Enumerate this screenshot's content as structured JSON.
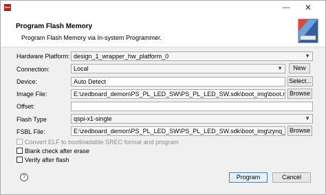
{
  "window": {
    "app_icon_text": "SDK"
  },
  "header": {
    "title": "Program Flash Memory",
    "description": "Program Flash Memory via In-system Programmer."
  },
  "form": {
    "hardware_platform": {
      "label": "Hardware Platform:",
      "value": "design_1_wrapper_hw_platform_0"
    },
    "connection": {
      "label": "Connection:",
      "value": "Local",
      "button": "New"
    },
    "device": {
      "label": "Device:",
      "value": "Auto Detect",
      "button": "Select..."
    },
    "image_file": {
      "label": "Image File:",
      "value": "E:\\zedboard_demon\\PS_PL_LED_SW\\PS_PL_LED_SW.sdk\\boot_img\\boot.mcs",
      "button": "Browse"
    },
    "offset": {
      "label": "Offset:",
      "value": ""
    },
    "flash_type": {
      "label": "Flash Type",
      "value": "qspi-x1-single"
    },
    "fsbl_file": {
      "label": "FSBL File:",
      "value": "E:\\zedboard_demon\\PS_PL_LED_SW\\PS_PL_LED_SW.sdk\\boot_img\\zynq_fsbl.elf",
      "button": "Browse"
    }
  },
  "options": [
    {
      "label": "Convert ELF to bootloadable SREC format and program",
      "enabled": false
    },
    {
      "label": "Blank check after erase",
      "enabled": true
    },
    {
      "label": "Verify after flash",
      "enabled": true
    }
  ],
  "footer": {
    "help_glyph": "?",
    "program_label": "Program",
    "cancel_label": "Cancel"
  },
  "colors": {
    "accent_border": "#3c7fb1",
    "brand_icon": "#b31b1b"
  }
}
